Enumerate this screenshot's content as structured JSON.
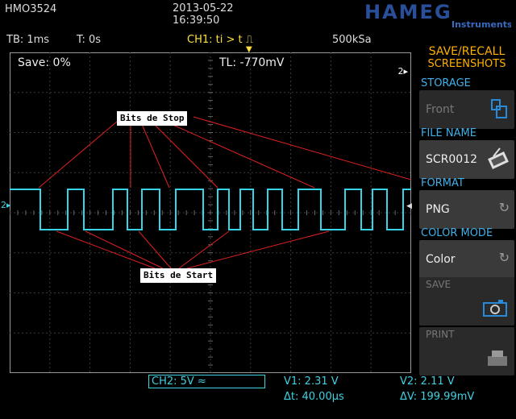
{
  "header": {
    "model": "HMO3524",
    "date": "2013-05-22",
    "time": "16:39:50",
    "logo_text": "HAMEG",
    "logo_sub": "Instruments"
  },
  "topbar": {
    "timebase": "TB: 1ms",
    "trigger_pos": "T: 0s",
    "trigger": "CH1: ti > t ⎍",
    "sample_rate": "500kSa"
  },
  "screen": {
    "save_status": "Save: 0%",
    "trigger_level": "TL:  -770mV",
    "ch_marker_right": "2▸",
    "ch_marker_left": "2▸",
    "annotations": {
      "stop_bits": "Bits de Stop",
      "start_bits": "Bits de Start"
    }
  },
  "bottom": {
    "ch2": "CH2: 5V ≈",
    "v1": "V1: 2.31 V",
    "dt": "Δt: 40.00µs",
    "v2": "V2: 2.11 V",
    "dv": "ΔV: 199.99mV"
  },
  "menu": {
    "title1": "SAVE/RECALL",
    "title2": "SCREENSHOTS",
    "storage_label": "STORAGE",
    "storage_value": "Front",
    "filename_label": "FILE NAME",
    "filename_value": "SCR0012",
    "format_label": "FORMAT",
    "format_value": "PNG",
    "colormode_label": "COLOR MODE",
    "colormode_value": "Color",
    "save_label": "SAVE",
    "print_label": "PRINT"
  },
  "colors": {
    "trace": "#35d4e8",
    "trigger": "#ffe040",
    "menu_title": "#ffb000",
    "label": "#40b0e8"
  }
}
